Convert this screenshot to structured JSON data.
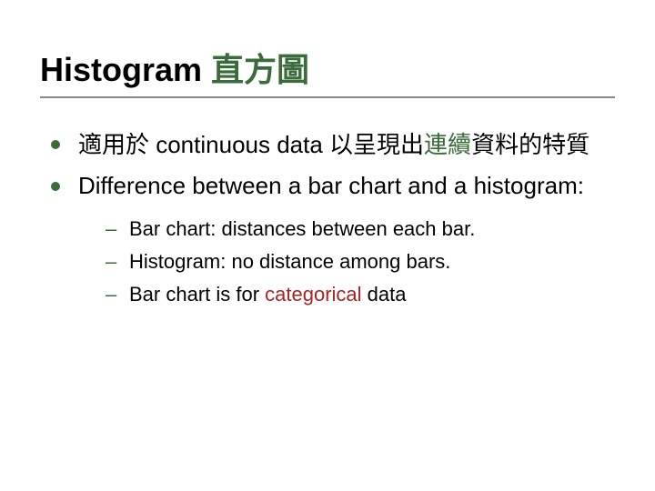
{
  "title": {
    "plain": "Histogram ",
    "accent": "直方圖"
  },
  "bullets": [
    {
      "segments": [
        {
          "text": "適用於 continuous data 以呈現出",
          "class": ""
        },
        {
          "text": "連續",
          "class": "accent-text"
        },
        {
          "text": "資料的特質",
          "class": ""
        }
      ]
    },
    {
      "segments": [
        {
          "text": "Difference between a bar chart and a histogram:",
          "class": ""
        }
      ],
      "sub": [
        {
          "segments": [
            {
              "text": "Bar chart: distances between each bar.",
              "class": ""
            }
          ]
        },
        {
          "segments": [
            {
              "text": "Histogram: no distance among bars.",
              "class": ""
            }
          ]
        },
        {
          "segments": [
            {
              "text": "Bar chart is for ",
              "class": ""
            },
            {
              "text": "categorical",
              "class": "emph-red"
            },
            {
              "text": " data",
              "class": ""
            }
          ]
        }
      ]
    }
  ]
}
